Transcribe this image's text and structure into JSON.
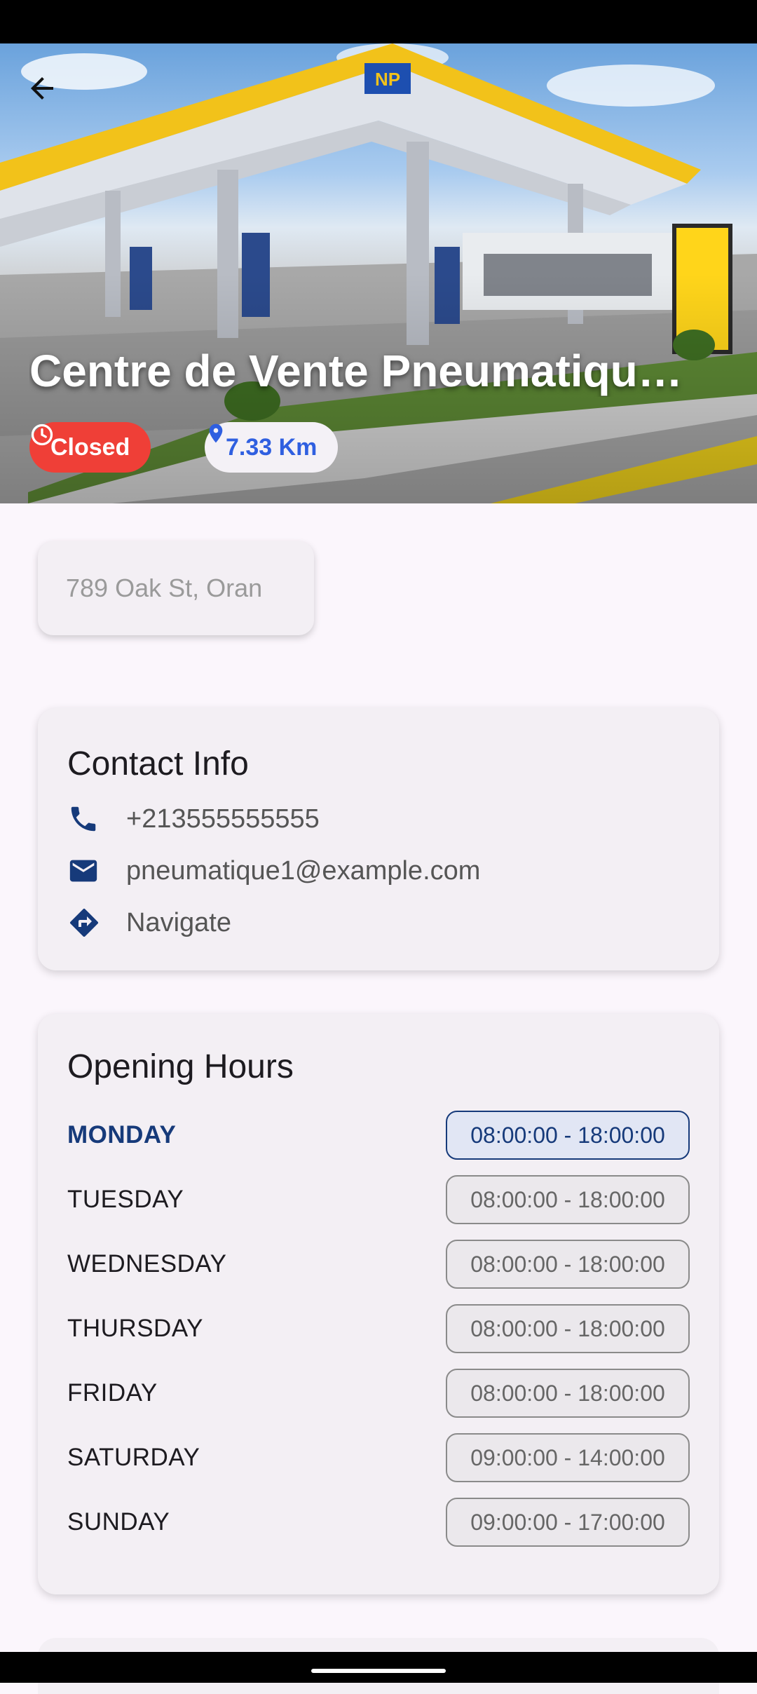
{
  "station": {
    "title": "Centre de Vente Pneumatiqu…",
    "status": "Closed",
    "distance": "7.33 Km",
    "address": "789 Oak St, Oran"
  },
  "contact": {
    "heading": "Contact Info",
    "phone": "+213555555555",
    "email": "pneumatique1@example.com",
    "navigate": "Navigate"
  },
  "hours": {
    "heading": "Opening Hours",
    "days": [
      {
        "day": "MONDAY",
        "time": "08:00:00 - 18:00:00"
      },
      {
        "day": "TUESDAY",
        "time": "08:00:00 - 18:00:00"
      },
      {
        "day": "WEDNESDAY",
        "time": "08:00:00 - 18:00:00"
      },
      {
        "day": "THURSDAY",
        "time": "08:00:00 - 18:00:00"
      },
      {
        "day": "FRIDAY",
        "time": "08:00:00 - 18:00:00"
      },
      {
        "day": "SATURDAY",
        "time": "09:00:00 - 14:00:00"
      },
      {
        "day": "SUNDAY",
        "time": "09:00:00 - 17:00:00"
      }
    ]
  },
  "hero_logo_text": "NP",
  "colors": {
    "closed": "#ef3f37",
    "distance": "#2f5fe0",
    "accent": "#163a7a",
    "background": "#fbf6fc",
    "card": "#f3eff4"
  },
  "icons": [
    "back-arrow-icon",
    "clock-icon",
    "location-pin-icon",
    "phone-icon",
    "email-icon",
    "directions-icon"
  ]
}
